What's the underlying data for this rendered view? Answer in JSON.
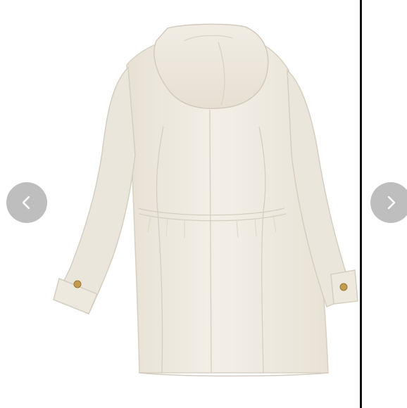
{
  "carousel": {
    "image": {
      "subject": "coat-back-view",
      "main_color": "#efeae0",
      "shadow_color": "#ddd6c8",
      "button_color": "#c49a4e"
    },
    "prev_button": {
      "icon": "chevron-left-icon",
      "color": "#b0b0b0"
    },
    "next_button": {
      "icon": "chevron-right-icon",
      "color": "#b0b0b0"
    },
    "divider_color": "#111111"
  }
}
